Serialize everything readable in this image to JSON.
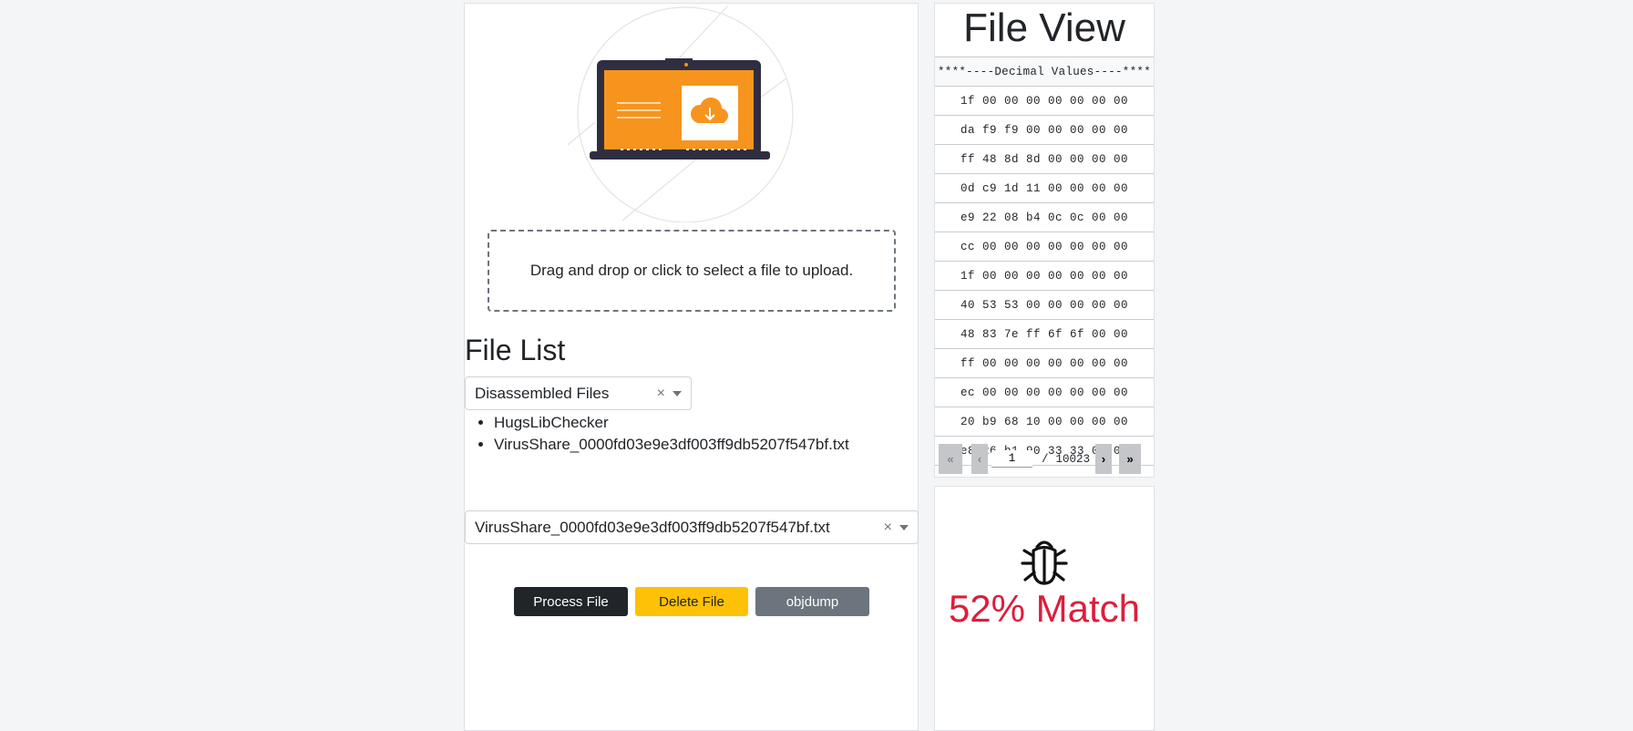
{
  "upload": {
    "dropzone_text": "Drag and drop or click to select a file to upload."
  },
  "file_list": {
    "heading": "File List",
    "category_select": {
      "value": "Disassembled Files",
      "clear": "×"
    },
    "files": [
      "HugsLibChecker",
      "VirusShare_0000fd03e9e3df003ff9db5207f547bf.txt"
    ],
    "file_select": {
      "value": "VirusShare_0000fd03e9e3df003ff9db5207f547bf.txt",
      "clear": "×"
    }
  },
  "actions": {
    "process": "Process File",
    "delete": "Delete File",
    "objdump": "objdump"
  },
  "file_view": {
    "title": "File View",
    "header": "****----Decimal Values----****",
    "rows": [
      "1f 00 00 00 00 00 00 00",
      "da f9 f9 00 00 00 00 00",
      "ff 48 8d 8d 00 00 00 00",
      "0d c9 1d 11 00 00 00 00",
      "e9 22 08 b4 0c 0c 00 00",
      "cc 00 00 00 00 00 00 00",
      "1f 00 00 00 00 00 00 00",
      "40 53 53 00 00 00 00 00",
      "48 83 7e ff 6f 6f 00 00",
      "ff 00 00 00 00 00 00 00",
      "ec 00 00 00 00 00 00 00",
      "20 b9 68 10 00 00 00 00",
      "e8 26 b1 90 33 33 00 00"
    ],
    "pager": {
      "page": "1",
      "separator": "/",
      "total": "10023"
    }
  },
  "result": {
    "match_text": "52% Match",
    "color": "#dc1e3c",
    "icon": "bug-icon"
  },
  "colors": {
    "process": "#212529",
    "delete": "#ffc107",
    "objdump": "#6c757d",
    "illustration": "#f7941d"
  }
}
